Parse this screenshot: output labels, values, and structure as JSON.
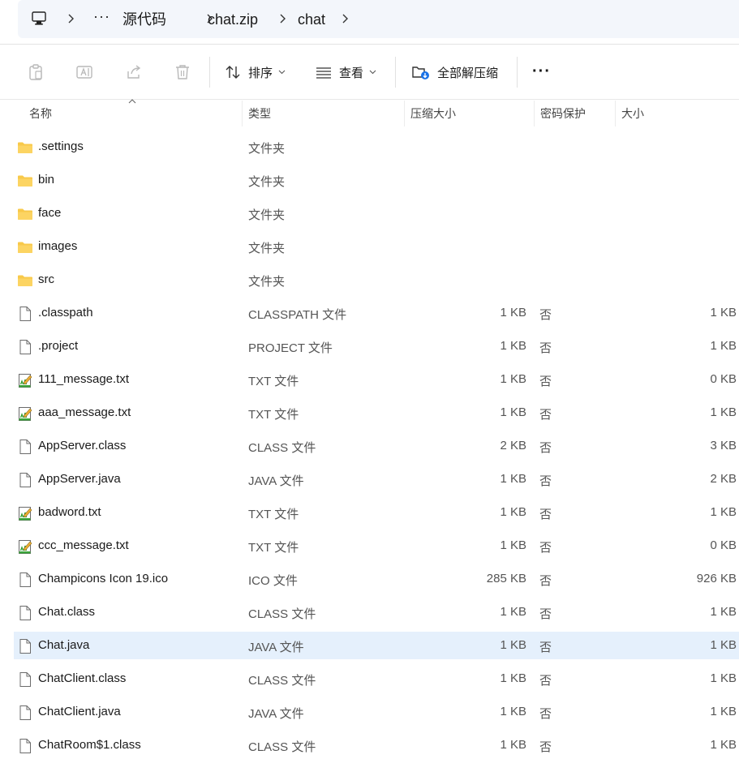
{
  "breadcrumb": {
    "root_icon": "this-pc-icon",
    "overflow": "···",
    "items": [
      "源代码",
      "chat.zip",
      "chat"
    ]
  },
  "toolbar": {
    "icons": [
      "paste-icon",
      "rename-icon",
      "share-icon",
      "delete-icon"
    ],
    "sort_label": "排序",
    "view_label": "查看",
    "extract_all_label": "全部解压缩",
    "more_label": "···"
  },
  "columns": {
    "name": "名称",
    "type": "类型",
    "compressed": "压缩大小",
    "password": "密码保护",
    "size": "大小"
  },
  "files": [
    {
      "name": ".settings",
      "type": "文件夹",
      "compressed": "",
      "password": "",
      "size": "",
      "icon": "folder-icon"
    },
    {
      "name": "bin",
      "type": "文件夹",
      "compressed": "",
      "password": "",
      "size": "",
      "icon": "folder-icon"
    },
    {
      "name": "face",
      "type": "文件夹",
      "compressed": "",
      "password": "",
      "size": "",
      "icon": "folder-icon"
    },
    {
      "name": "images",
      "type": "文件夹",
      "compressed": "",
      "password": "",
      "size": "",
      "icon": "folder-icon"
    },
    {
      "name": "src",
      "type": "文件夹",
      "compressed": "",
      "password": "",
      "size": "",
      "icon": "folder-icon"
    },
    {
      "name": ".classpath",
      "type": "CLASSPATH 文件",
      "compressed": "1 KB",
      "password": "否",
      "size": "1 KB",
      "icon": "file-icon"
    },
    {
      "name": ".project",
      "type": "PROJECT 文件",
      "compressed": "1 KB",
      "password": "否",
      "size": "1 KB",
      "icon": "file-icon"
    },
    {
      "name": "111_message.txt",
      "type": "TXT 文件",
      "compressed": "1 KB",
      "password": "否",
      "size": "0 KB",
      "icon": "text-file-icon"
    },
    {
      "name": "aaa_message.txt",
      "type": "TXT 文件",
      "compressed": "1 KB",
      "password": "否",
      "size": "1 KB",
      "icon": "text-file-icon"
    },
    {
      "name": "AppServer.class",
      "type": "CLASS 文件",
      "compressed": "2 KB",
      "password": "否",
      "size": "3 KB",
      "icon": "file-icon"
    },
    {
      "name": "AppServer.java",
      "type": "JAVA 文件",
      "compressed": "1 KB",
      "password": "否",
      "size": "2 KB",
      "icon": "file-icon"
    },
    {
      "name": "badword.txt",
      "type": "TXT 文件",
      "compressed": "1 KB",
      "password": "否",
      "size": "1 KB",
      "icon": "text-file-icon"
    },
    {
      "name": "ccc_message.txt",
      "type": "TXT 文件",
      "compressed": "1 KB",
      "password": "否",
      "size": "0 KB",
      "icon": "text-file-icon"
    },
    {
      "name": "Champicons Icon 19.ico",
      "type": "ICO 文件",
      "compressed": "285 KB",
      "password": "否",
      "size": "926 KB",
      "icon": "file-icon"
    },
    {
      "name": "Chat.class",
      "type": "CLASS 文件",
      "compressed": "1 KB",
      "password": "否",
      "size": "1 KB",
      "icon": "file-icon"
    },
    {
      "name": "Chat.java",
      "type": "JAVA 文件",
      "compressed": "1 KB",
      "password": "否",
      "size": "1 KB",
      "icon": "file-icon",
      "selected": true
    },
    {
      "name": "ChatClient.class",
      "type": "CLASS 文件",
      "compressed": "1 KB",
      "password": "否",
      "size": "1 KB",
      "icon": "file-icon"
    },
    {
      "name": "ChatClient.java",
      "type": "JAVA 文件",
      "compressed": "1 KB",
      "password": "否",
      "size": "1 KB",
      "icon": "file-icon"
    },
    {
      "name": "ChatRoom$1.class",
      "type": "CLASS 文件",
      "compressed": "1 KB",
      "password": "否",
      "size": "1 KB",
      "icon": "file-icon"
    }
  ],
  "colors": {
    "selected_row": "#e5f0fc",
    "folder": "#f8c94a",
    "accent": "#1a73e8"
  }
}
